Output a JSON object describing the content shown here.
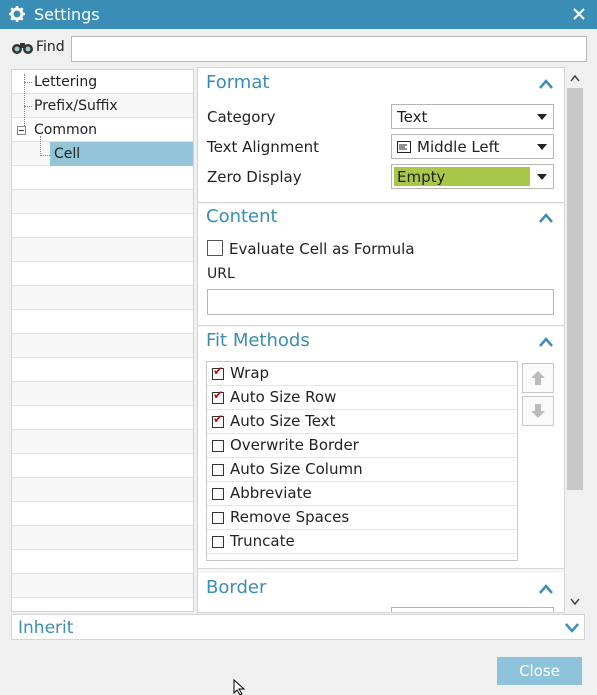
{
  "window": {
    "title": "Settings"
  },
  "find": {
    "label": "Find",
    "value": ""
  },
  "tree": {
    "items": [
      {
        "label": "Lettering"
      },
      {
        "label": "Prefix/Suffix"
      },
      {
        "label": "Common"
      },
      {
        "label": "Cell",
        "selected": true
      }
    ]
  },
  "format": {
    "title": "Format",
    "category_label": "Category",
    "category_value": "Text",
    "alignment_label": "Text Alignment",
    "alignment_value": "Middle Left",
    "zero_label": "Zero Display",
    "zero_value": "Empty"
  },
  "content": {
    "title": "Content",
    "evaluate_label": "Evaluate Cell as Formula",
    "evaluate_checked": false,
    "url_label": "URL",
    "url_value": ""
  },
  "fit": {
    "title": "Fit Methods",
    "items": [
      {
        "label": "Wrap",
        "checked": true
      },
      {
        "label": "Auto Size Row",
        "checked": true
      },
      {
        "label": "Auto Size Text",
        "checked": true
      },
      {
        "label": "Overwrite Border",
        "checked": false
      },
      {
        "label": "Auto Size Column",
        "checked": false
      },
      {
        "label": "Abbreviate",
        "checked": false
      },
      {
        "label": "Remove Spaces",
        "checked": false
      },
      {
        "label": "Truncate",
        "checked": false
      }
    ]
  },
  "border": {
    "title": "Border"
  },
  "inherit": {
    "label": "Inherit"
  },
  "footer": {
    "close_label": "Close"
  },
  "colors": {
    "accent": "#3a8db4",
    "highlight": "#ffff4d",
    "selected_tree": "#93c5d6",
    "dropdown_highlight": "#a8c84c",
    "button": "#8ec3dc"
  }
}
